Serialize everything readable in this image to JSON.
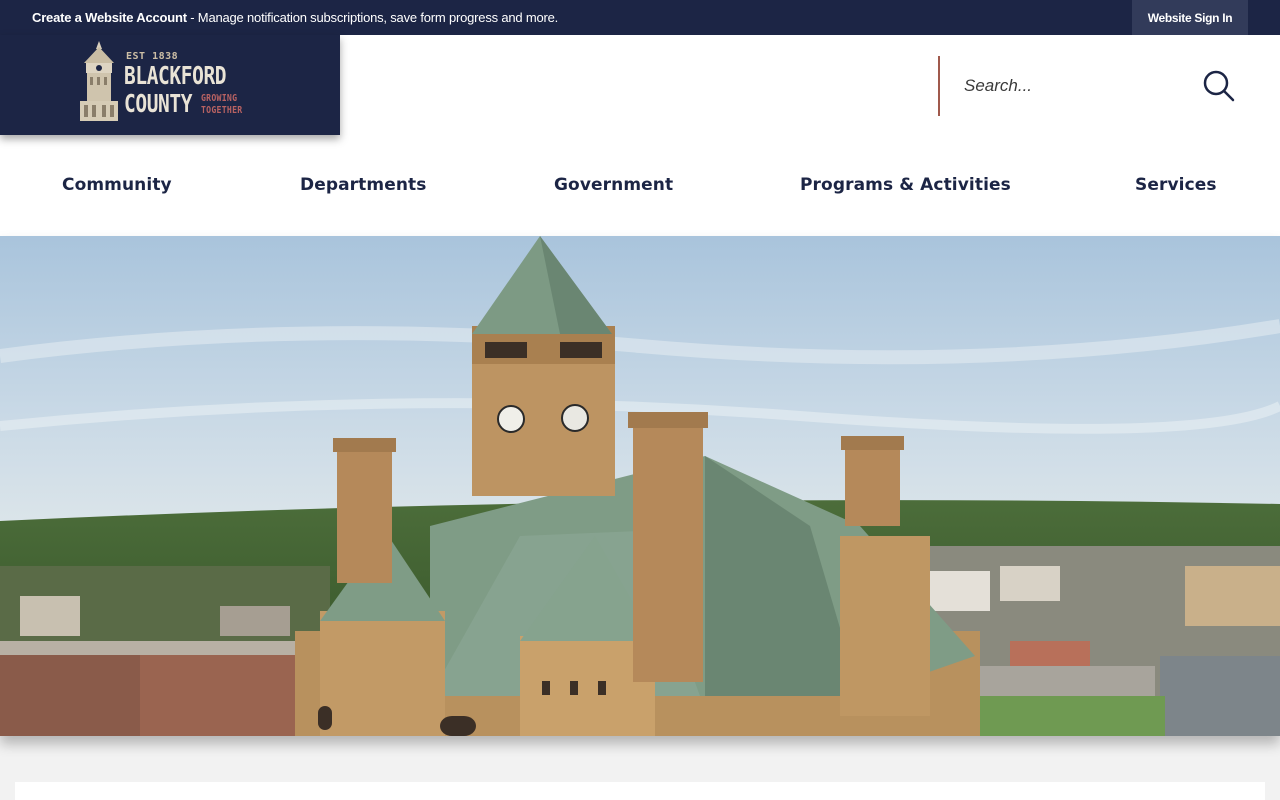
{
  "topbar": {
    "account_bold": "Create a Website Account",
    "account_text": " - Manage notification subscriptions, save form progress and more.",
    "signin_label": "Website Sign In"
  },
  "logo": {
    "est": "EST 1838",
    "line1": "BLACKFORD",
    "line2": "COUNTY",
    "tagline1": "GROWING",
    "tagline2": "TOGETHER"
  },
  "search": {
    "placeholder": "Search...",
    "icon": "search-icon"
  },
  "nav": {
    "items": [
      {
        "label": "Community"
      },
      {
        "label": "Departments"
      },
      {
        "label": "Government"
      },
      {
        "label": "Programs & Activities"
      },
      {
        "label": "Services"
      }
    ]
  },
  "hero": {
    "image": "courthouse-aerial-photo"
  },
  "colors": {
    "navy": "#1c2545",
    "signin_bg": "#323b5a",
    "accent": "#a0594c",
    "tagline": "#b86262"
  }
}
